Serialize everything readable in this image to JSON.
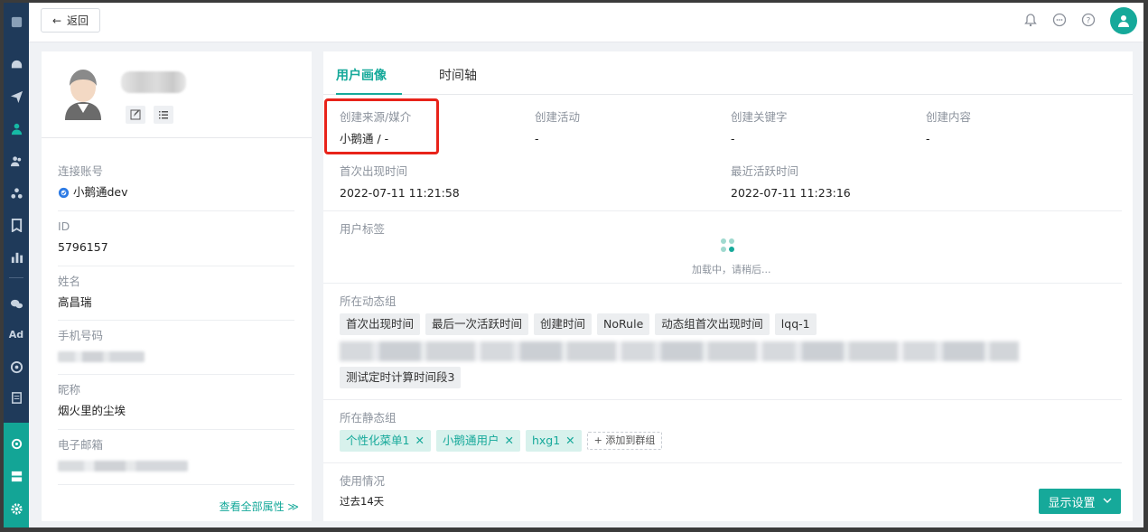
{
  "topbar": {
    "back_label": "返回"
  },
  "profile": {
    "view_all_label": "查看全部属性 ≫",
    "fields": [
      {
        "label": "连接账号",
        "value": "小鹅通dev"
      },
      {
        "label": "ID",
        "value": "5796157"
      },
      {
        "label": "姓名",
        "value": "高昌瑞"
      },
      {
        "label": "手机号码",
        "value": ""
      },
      {
        "label": "昵称",
        "value": "烟火里的尘埃"
      },
      {
        "label": "电子邮箱",
        "value": ""
      }
    ]
  },
  "tabs": [
    {
      "label": "用户画像",
      "active": true
    },
    {
      "label": "时间轴",
      "active": false
    }
  ],
  "attributes": {
    "row1": [
      {
        "label": "创建来源/媒介",
        "value": "小鹅通 / -"
      },
      {
        "label": "创建活动",
        "value": "-"
      },
      {
        "label": "创建关键字",
        "value": "-"
      },
      {
        "label": "创建内容",
        "value": "-"
      }
    ],
    "row2": [
      {
        "label": "首次出现时间",
        "value": "2022-07-11 11:21:58"
      },
      {
        "label": "最近活跃时间",
        "value": "2022-07-11 11:23:16"
      }
    ]
  },
  "user_tags": {
    "title": "用户标签",
    "loading_text": "加载中，请稍后..."
  },
  "dynamic_groups": {
    "title": "所在动态组",
    "tags": [
      "首次出现时间",
      "最后一次活跃时间",
      "创建时间",
      "NoRule",
      "动态组首次出现时间",
      "lqq-1"
    ],
    "tags_row3": [
      "测试定时计算时间段3"
    ]
  },
  "static_groups": {
    "title": "所在静态组",
    "tags": [
      "个性化菜单1",
      "小鹅通用户",
      "hxg1"
    ],
    "add_label": "+ 添加到群组"
  },
  "usage": {
    "title": "使用情况",
    "period": "过去14天",
    "settings_button": "显示设置"
  },
  "colors": {
    "accent": "#16a99a",
    "highlight_border": "#e8231a",
    "rail": "#1f3a5a"
  }
}
